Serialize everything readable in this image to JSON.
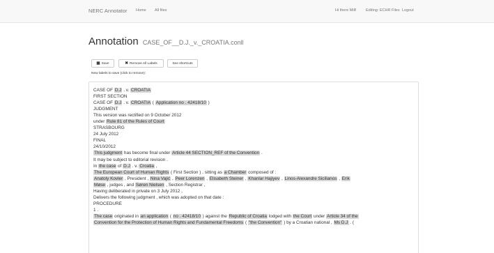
{
  "nav": {
    "brand": "NERC Annotator",
    "home": "Home",
    "all_files": "All files",
    "greeting": "Hi there Mill!",
    "editing": "Editing: ECHR Files",
    "logout": "Logout"
  },
  "page": {
    "title": "Annotation",
    "filename": "CASE_OF__D.J._v._CROATIA.conll"
  },
  "toolbar": {
    "save_label": "Save",
    "save_icon": "floppy-icon",
    "remove_label": "Remove All Labels",
    "remove_icon": "x-icon",
    "shortcuts_label": "See shortcuts",
    "new_labels_text": "New labels to save (click to remove):"
  },
  "document": {
    "lines": [
      [
        {
          "t": "CASE OF "
        },
        {
          "t": "D.J",
          "e": true
        },
        {
          "t": " . v. "
        },
        {
          "t": "CROATIA",
          "e": true
        }
      ],
      [
        {
          "t": "FIRST SECTION"
        }
      ],
      [
        {
          "t": "CASE OF "
        },
        {
          "t": "D.J",
          "e": true
        },
        {
          "t": " . v. "
        },
        {
          "t": "CROATIA",
          "e": true
        },
        {
          "t": " ( "
        },
        {
          "t": "Application no . 42418/10",
          "e": true
        },
        {
          "t": " )"
        }
      ],
      [
        {
          "t": "JUDGMENT"
        }
      ],
      [
        {
          "t": "This version was rectified on 9 October 2012"
        }
      ],
      [
        {
          "t": "under "
        },
        {
          "t": "Rule 81 of the Rules of Court",
          "e": true
        }
      ],
      [
        {
          "t": "STRASBOURG"
        }
      ],
      [
        {
          "t": "24 July 2012"
        }
      ],
      [
        {
          "t": "FINAL"
        }
      ],
      [
        {
          "t": "24/10/2012"
        }
      ],
      [
        {
          "t": "This judgment",
          "e": true
        },
        {
          "t": " has become final under "
        },
        {
          "t": "Article 44 SECTION_REF of the Convention",
          "e": true
        },
        {
          "t": " ."
        }
      ],
      [
        {
          "t": "It may be subject to editorial revision ."
        }
      ],
      [
        {
          "t": "In "
        },
        {
          "t": "the case",
          "e": true
        },
        {
          "t": " of "
        },
        {
          "t": "D.J",
          "e": true
        },
        {
          "t": " . v. "
        },
        {
          "t": "Croatia",
          "e": true
        },
        {
          "t": " ,"
        }
      ],
      [
        {
          "t": "The European Court of Human Rights",
          "e": true
        },
        {
          "t": " ( First Section ) , sitting as "
        },
        {
          "t": "a Chamber",
          "e": true
        },
        {
          "t": " composed of :"
        }
      ],
      [
        {
          "t": "Anatoly Kovler",
          "e": true
        },
        {
          "t": " , President , "
        },
        {
          "t": "Nina Vajić",
          "e": true
        },
        {
          "t": " , "
        },
        {
          "t": "Peer Lorenzen",
          "e": true
        },
        {
          "t": " , "
        },
        {
          "t": "Elisabeth Steiner",
          "e": true
        },
        {
          "t": " , "
        },
        {
          "t": "Khanlar Hajiyev",
          "e": true
        },
        {
          "t": " , "
        },
        {
          "t": "Linos-Alexandre Sicilianos",
          "e": true
        },
        {
          "t": " , "
        },
        {
          "t": "Erik",
          "e": true
        }
      ],
      [
        {
          "t": "Møse",
          "e": true
        },
        {
          "t": " , judges , and "
        },
        {
          "t": "Søren Nielsen",
          "e": true
        },
        {
          "t": " , Section Registrar ,"
        }
      ],
      [
        {
          "t": "Having deliberated in private on 3 July 2012 ,"
        }
      ],
      [
        {
          "t": "Delivers the following judgment , which was adopted on that date :"
        }
      ],
      [
        {
          "t": "PROCEDURE"
        }
      ],
      [
        {
          "t": "1 ."
        }
      ],
      [
        {
          "t": "The case",
          "e": true
        },
        {
          "t": " originated in "
        },
        {
          "t": "an application",
          "e": true
        },
        {
          "t": " ( "
        },
        {
          "t": "no . 42418/10",
          "e": true
        },
        {
          "t": " ) against the "
        },
        {
          "t": "Republic of Croatia",
          "e": true
        },
        {
          "t": " lodged with "
        },
        {
          "t": "the Court",
          "e": true
        },
        {
          "t": " under "
        },
        {
          "t": "Article 34 of the",
          "e": true
        }
      ],
      [
        {
          "t": "Convention for the Protection of Human Rights and Fundamental Freedoms",
          "e": true
        },
        {
          "t": " ( "
        },
        {
          "t": "\"the Convention\"",
          "e": true
        },
        {
          "t": " ) by a Croatian national , "
        },
        {
          "t": "Ms D.J",
          "e": true
        },
        {
          "t": " . ("
        }
      ]
    ]
  }
}
